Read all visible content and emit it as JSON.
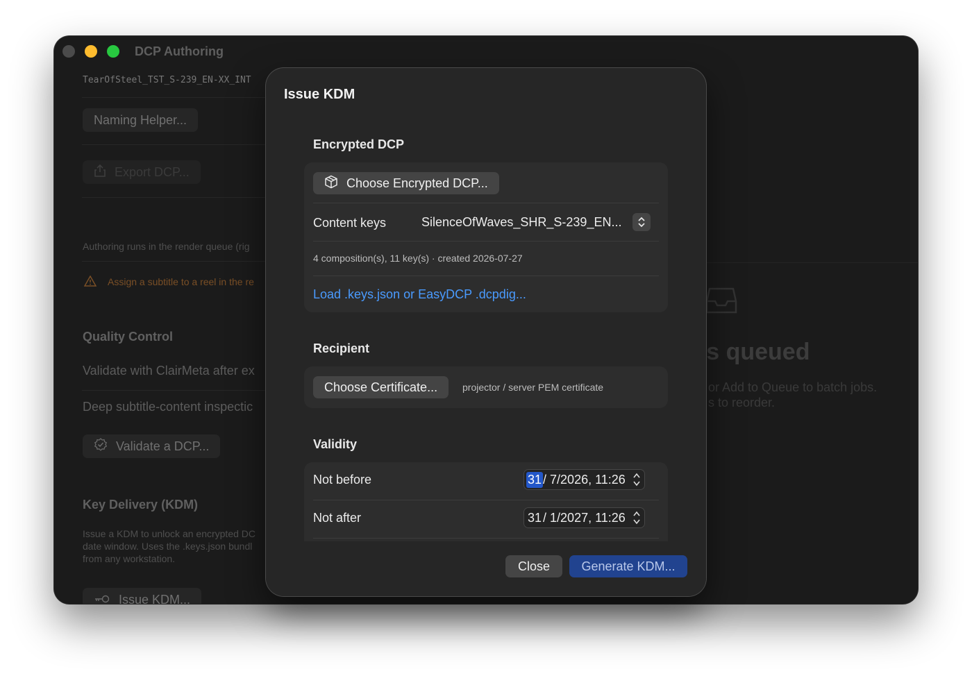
{
  "window": {
    "title": "DCP Authoring"
  },
  "sidebar": {
    "project_name": "TearOfSteel_TST_S-239_EN-XX_INT",
    "naming_helper": "Naming Helper...",
    "export_dcp": "Export DCP...",
    "render_note": "Authoring runs in the render queue (rig",
    "warning": "Assign a subtitle to a reel in the re",
    "qc_title": "Quality Control",
    "qc_validate": "Validate with ClairMeta after ex",
    "qc_deep": "Deep subtitle-content inspectic",
    "validate_button": "Validate a DCP...",
    "kdm_title": "Key Delivery (KDM)",
    "kdm_desc_1": "Issue a KDM to unlock an encrypted DC",
    "kdm_desc_2": "date window. Uses the .keys.json bundl",
    "kdm_desc_3": "from any workstation.",
    "issue_button": "Issue KDM..."
  },
  "main": {
    "empty_title": "rs queued",
    "empty_line1": "or Add to Queue to batch jobs.",
    "empty_line2": "s to reorder."
  },
  "dialog": {
    "title": "Issue KDM",
    "encrypted": {
      "heading": "Encrypted DCP",
      "choose_button": "Choose Encrypted DCP...",
      "content_keys_label": "Content keys",
      "content_keys_value": "SilenceOfWaves_SHR_S-239_EN...",
      "summary": "4 composition(s), 11 key(s) · created 2026-07-27",
      "load_link": "Load .keys.json or EasyDCP .dcpdig..."
    },
    "recipient": {
      "heading": "Recipient",
      "choose_button": "Choose Certificate...",
      "hint": "projector / server PEM certificate"
    },
    "validity": {
      "heading": "Validity",
      "not_before_label": "Not before",
      "not_before_day": "31",
      "not_before_rest": "/  7/2026, 11:26",
      "not_after_label": "Not after",
      "not_after_day": "31",
      "not_after_rest": "/  1/2027, 11:26"
    },
    "close_button": "Close",
    "generate_button": "Generate KDM..."
  },
  "colors": {
    "accent": "#2357c9",
    "link": "#4a9bff",
    "warning": "#8a5a2a",
    "primary_button": "#21438f"
  }
}
